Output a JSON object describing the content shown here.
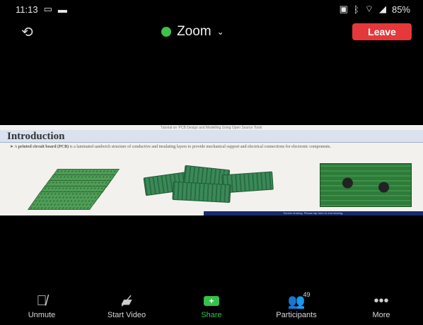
{
  "status_bar": {
    "time": "11:13",
    "left_icons": [
      "message-icon",
      "battery-saver-icon"
    ],
    "right_icons": [
      "sim-icon",
      "bluetooth-icon",
      "wifi-icon",
      "signal-icon"
    ],
    "battery": "85%"
  },
  "header": {
    "meeting_title": "Zoom",
    "leave_label": "Leave",
    "shield_color": "#3ec24a",
    "leave_color": "#e5383b"
  },
  "shared_slide": {
    "caption": "Tutorial on 'PCB Design and Modelling Using Open Source Tools'",
    "heading": "Introduction",
    "bullet_prefix": "A",
    "bullet_term": "printed circuit board (PCB)",
    "bullet_text": "is a laminated sandwich structure of conductive and insulating layers to provide mechanical support and electrical connections for electronic components.",
    "presenter_strip": "Screen sharing. Please tap here to end sharing."
  },
  "toolbar": {
    "unmute": "Unmute",
    "start_video": "Start Video",
    "share": "Share",
    "participants": "Participants",
    "participants_count": "49",
    "more": "More",
    "share_color": "#35c14a"
  }
}
